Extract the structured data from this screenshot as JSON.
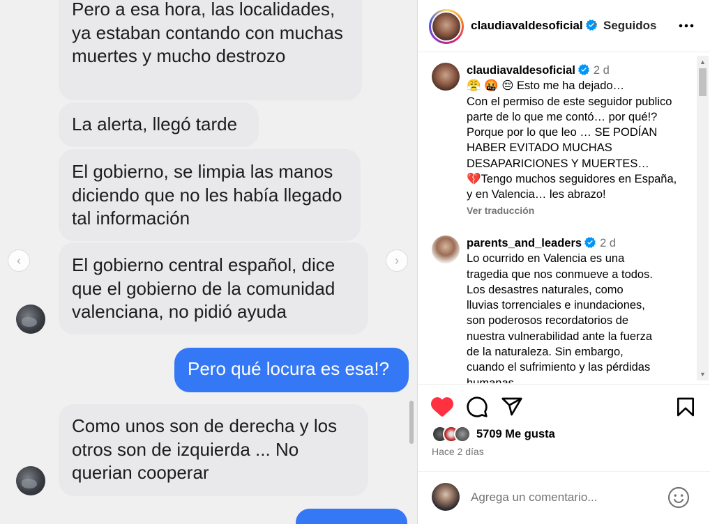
{
  "media": {
    "messages": [
      {
        "text": "Pero a esa hora, las localidades, ya estaban contando con muchas muertes y mucho destrozo",
        "from": "other"
      },
      {
        "text": "La alerta, llegó tarde",
        "from": "other"
      },
      {
        "text": "El gobierno, se limpia las manos diciendo que no les había llegado tal información",
        "from": "other"
      },
      {
        "text": "El gobierno central español, dice que el gobierno de la comunidad valenciana, no pidió ayuda",
        "from": "other"
      },
      {
        "text": "Pero qué locura es esa!?",
        "from": "me"
      },
      {
        "text": "Como unos son de derecha y los otros son de izquierda ... No querian cooperar",
        "from": "other"
      }
    ],
    "prev_arrow": "‹",
    "next_arrow": "›"
  },
  "header": {
    "username": "claudiavaldesoficial",
    "separator": "•",
    "follow_status": "Seguidos"
  },
  "comments": [
    {
      "username": "claudiavaldesoficial",
      "time": "2 d",
      "lines": [
        "😤 🤬 😔  Esto me ha dejado…",
        "Con el permiso de este seguidor publico parte de lo que me contó… por qué!? Porque por lo que leo … SE PODÍAN HABER EVITADO MUCHAS DESAPARICIONES Y MUERTES…",
        "💔Tengo muchos seguidores en España, y en Valencia… les abrazo!"
      ],
      "translate": "Ver traducción"
    },
    {
      "username": "parents_and_leaders",
      "time": "2 d",
      "text": "Lo ocurrido en Valencia es una tragedia que nos conmueve a todos. Los desastres naturales, como lluvias torrenciales e inundaciones, son poderosos recordatorios de nuestra vulnerabilidad ante la fuerza de la naturaleza. Sin embargo, cuando el sufrimiento y las pérdidas humanas"
    }
  ],
  "actions": {
    "likes": "5709 Me gusta",
    "ago": "Hace 2 días"
  },
  "comment_box": {
    "placeholder": "Agrega un comentario..."
  },
  "colors": {
    "me_bubble": "#3478f6",
    "other_bubble": "#e9e9eb",
    "like_red": "#ff3040",
    "verified_blue": "#0095f6",
    "muted": "#737373"
  },
  "icons": [
    "more-options-icon",
    "verified-icon",
    "heart-icon",
    "comment-icon",
    "share-icon",
    "bookmark-icon",
    "emoji-icon"
  ]
}
